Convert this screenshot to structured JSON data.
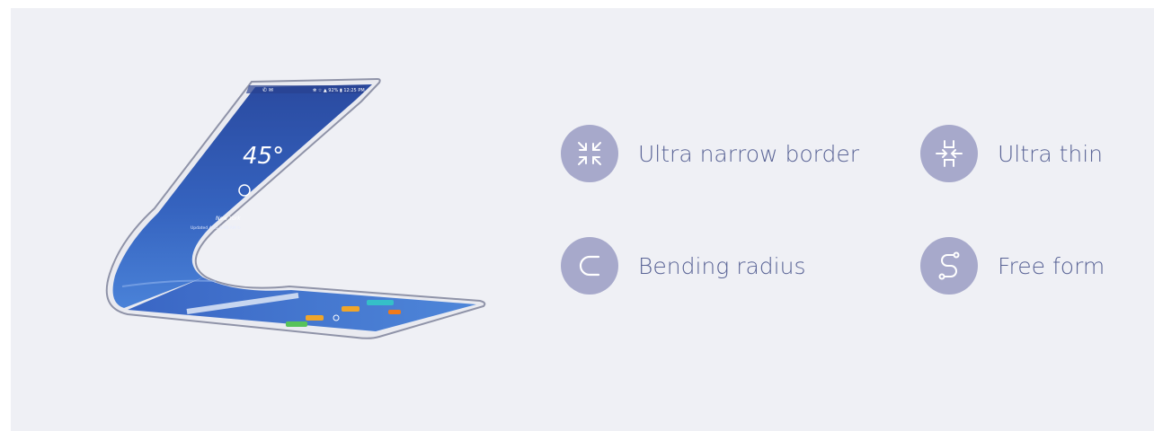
{
  "device": {
    "status_left": "✆ ✉",
    "status_right": "✻ ☆ ▲ 92% ▮ 12:25 PM",
    "temperature": "45°",
    "city": "New York",
    "updated_text": "Updated 4/15 9:00 AM ↻"
  },
  "features": [
    {
      "icon": "ultra-narrow-border-icon",
      "label": "Ultra narrow border"
    },
    {
      "icon": "ultra-thin-icon",
      "label": "Ultra thin"
    },
    {
      "icon": "bending-radius-icon",
      "label": "Bending radius"
    },
    {
      "icon": "free-form-icon",
      "label": "Free form"
    }
  ],
  "colors": {
    "panel_bg": "#eff0f5",
    "badge_bg": "#a7a9cb",
    "label_text": "#5a6496",
    "screen_top": "#2d4fa6",
    "screen_bottom": "#3f73cf"
  }
}
